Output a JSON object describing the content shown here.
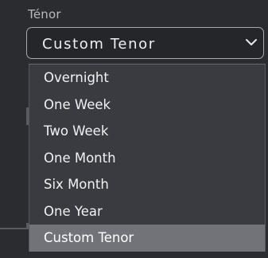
{
  "tenor_select": {
    "label": "Ténor",
    "selected_value": "Custom Tenor",
    "toggle_icon": "chevron-down-icon"
  },
  "dropdown": {
    "options": [
      {
        "label": "Overnight"
      },
      {
        "label": "One Week"
      },
      {
        "label": "Two Week"
      },
      {
        "label": "One Month"
      },
      {
        "label": "Six Month"
      },
      {
        "label": "One Year"
      },
      {
        "label": "Custom Tenor"
      }
    ],
    "selected_option": "Custom Tenor"
  },
  "colors": {
    "background": "#2b2c30",
    "list_background": "#3a3b40",
    "selected_background": "#727378",
    "border": "#a9aab0"
  }
}
